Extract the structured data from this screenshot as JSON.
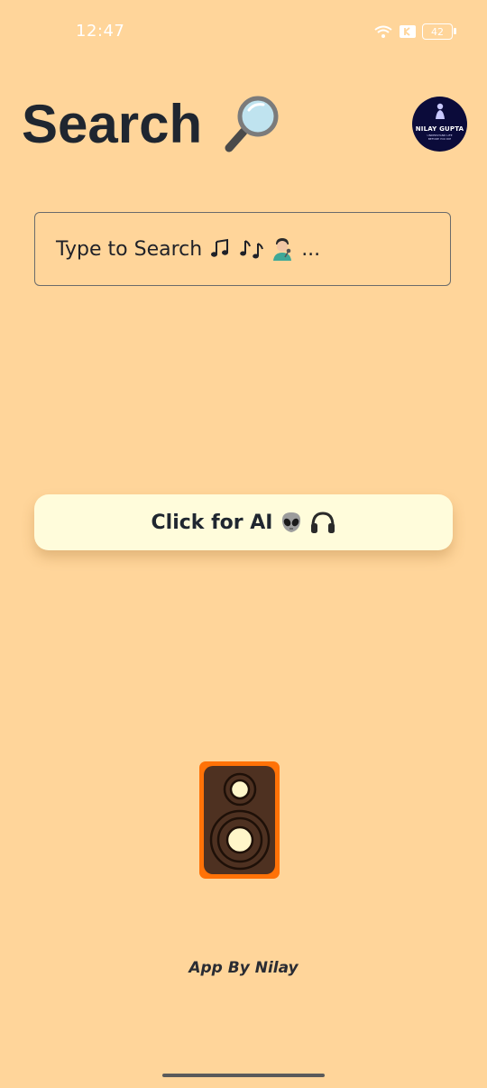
{
  "status_bar": {
    "time": "12:47",
    "battery_level": "42",
    "icons": [
      "wifi-icon",
      "k-icon",
      "battery-icon"
    ]
  },
  "header": {
    "title": "Search",
    "title_icon": "magnifier-icon",
    "avatar": {
      "name": "NILAY GUPTA",
      "subtext": "UNDERSTAND LIFE BEFORE\nYOU DIE"
    }
  },
  "search": {
    "placeholder": "Type to Search",
    "placeholder_icons": [
      "musical-note-icon",
      "musical-notes-icon",
      "singer-icon"
    ],
    "ellipsis": "..."
  },
  "ai_button": {
    "label": "Click for AI",
    "icons": [
      "alien-icon",
      "headphones-icon"
    ]
  },
  "illustration": {
    "icon": "speaker-icon"
  },
  "footer": {
    "credit": "App By Nilay"
  },
  "colors": {
    "background": "#FFD59A",
    "button_bg": "#FFFCDB",
    "speaker_orange": "#FF7207",
    "speaker_body": "#4E3121",
    "avatar_bg": "#0B0B3A"
  }
}
